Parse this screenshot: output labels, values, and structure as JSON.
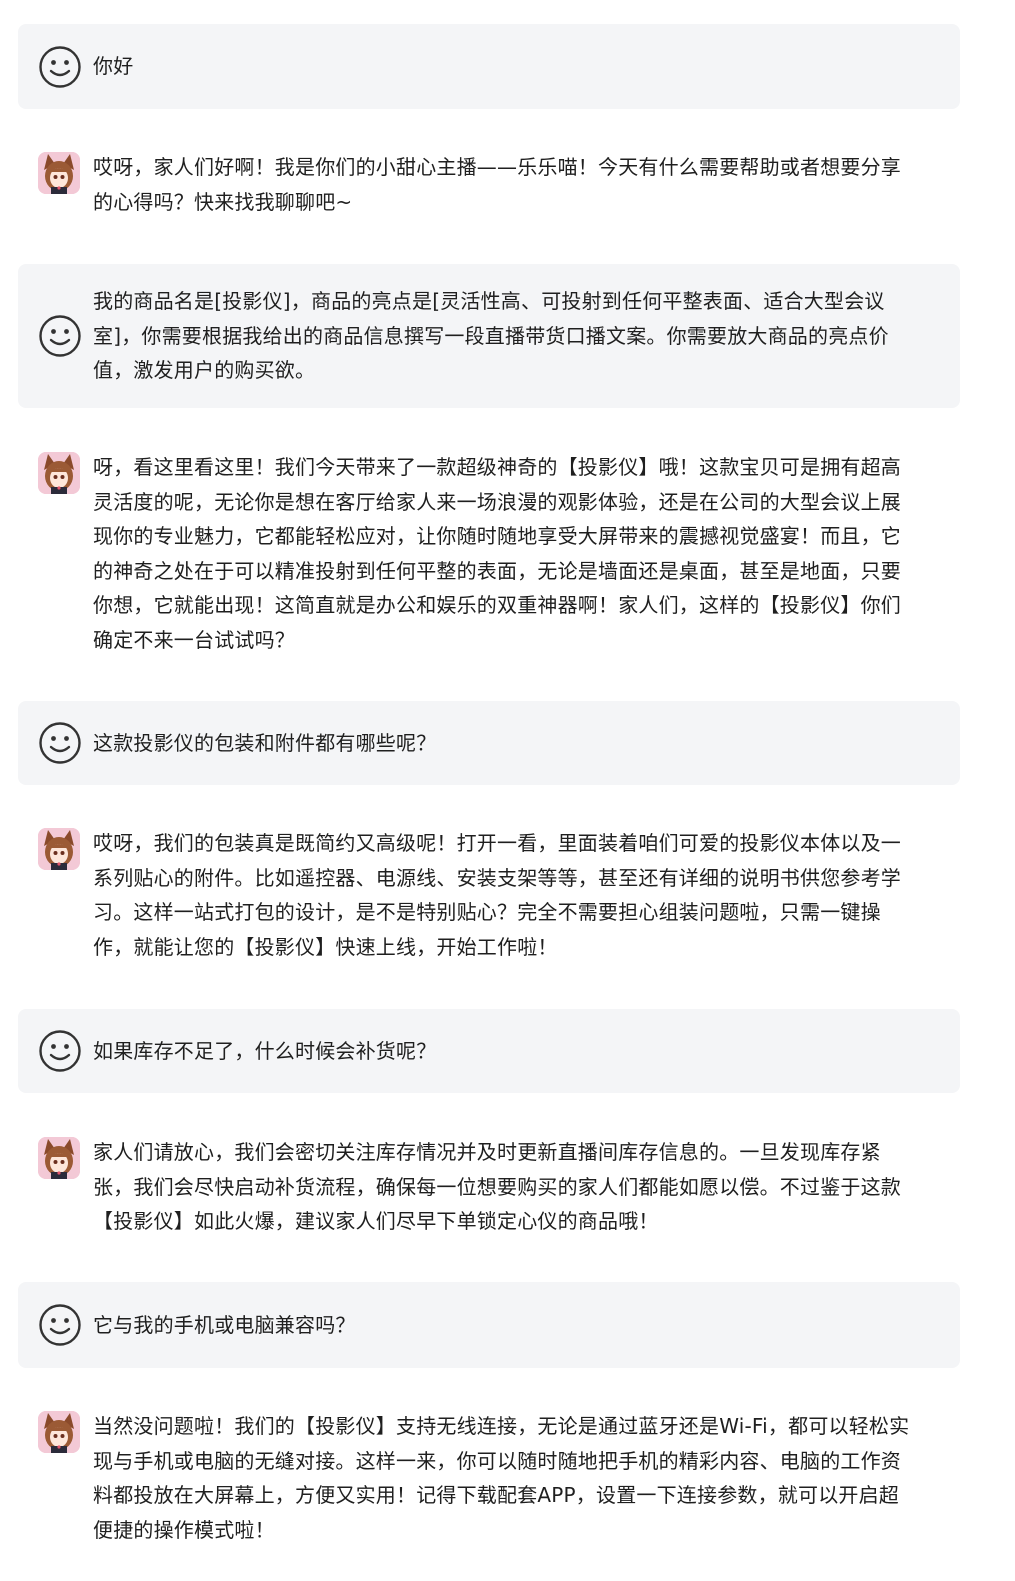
{
  "messages": [
    {
      "role": "user",
      "text": "你好"
    },
    {
      "role": "assistant",
      "text": "哎呀，家人们好啊！我是你们的小甜心主播——乐乐喵！今天有什么需要帮助或者想要分享\n的心得吗？快来找我聊聊吧~"
    },
    {
      "role": "user",
      "text": "我的商品名是[投影仪]，商品的亮点是[灵活性高、可投射到任何平整表面、适合大型会议\n室]，你需要根据我给出的商品信息撰写一段直播带货口播文案。你需要放大商品的亮点价\n值，激发用户的购买欲。"
    },
    {
      "role": "assistant",
      "text": "呀，看这里看这里！我们今天带来了一款超级神奇的【投影仪】哦！这款宝贝可是拥有超高\n灵活度的呢，无论你是想在客厅给家人来一场浪漫的观影体验，还是在公司的大型会议上展\n现你的专业魅力，它都能轻松应对，让你随时随地享受大屏带来的震撼视觉盛宴！而且，它\n的神奇之处在于可以精准投射到任何平整的表面，无论是墙面还是桌面，甚至是地面，只要\n你想，它就能出现！这简直就是办公和娱乐的双重神器啊！家人们，这样的【投影仪】你们\n确定不来一台试试吗？"
    },
    {
      "role": "user",
      "text": "这款投影仪的包装和附件都有哪些呢？"
    },
    {
      "role": "assistant",
      "text": "哎呀，我们的包装真是既简约又高级呢！打开一看，里面装着咱们可爱的投影仪本体以及一\n系列贴心的附件。比如遥控器、电源线、安装支架等等，甚至还有详细的说明书供您参考学\n习。这样一站式打包的设计，是不是特别贴心？完全不需要担心组装问题啦，只需一键操\n作，就能让您的【投影仪】快速上线，开始工作啦！"
    },
    {
      "role": "user",
      "text": "如果库存不足了，什么时候会补货呢？"
    },
    {
      "role": "assistant",
      "text": "家人们请放心，我们会密切关注库存情况并及时更新直播间库存信息的。一旦发现库存紧\n张，我们会尽快启动补货流程，确保每一位想要购买的家人们都能如愿以偿。不过鉴于这款\n【投影仪】如此火爆，建议家人们尽早下单锁定心仪的商品哦！"
    },
    {
      "role": "user",
      "text": "它与我的手机或电脑兼容吗？"
    },
    {
      "role": "assistant",
      "text": "当然没问题啦！我们的【投影仪】支持无线连接，无论是通过蓝牙还是Wi-Fi，都可以轻松实\n现与手机或电脑的无缝对接。这样一来，你可以随时随地把手机的精彩内容、电脑的工作资\n料都投放在大屏幕上，方便又实用！记得下载配套APP，设置一下连接参数，就可以开启超\n便捷的操作模式啦！"
    }
  ],
  "icons": {
    "user": "smiley-face-icon",
    "assistant": "anime-catgirl-avatar-icon"
  },
  "colors": {
    "user_bubble": "#f4f5f7",
    "text": "#1f1f1f"
  }
}
